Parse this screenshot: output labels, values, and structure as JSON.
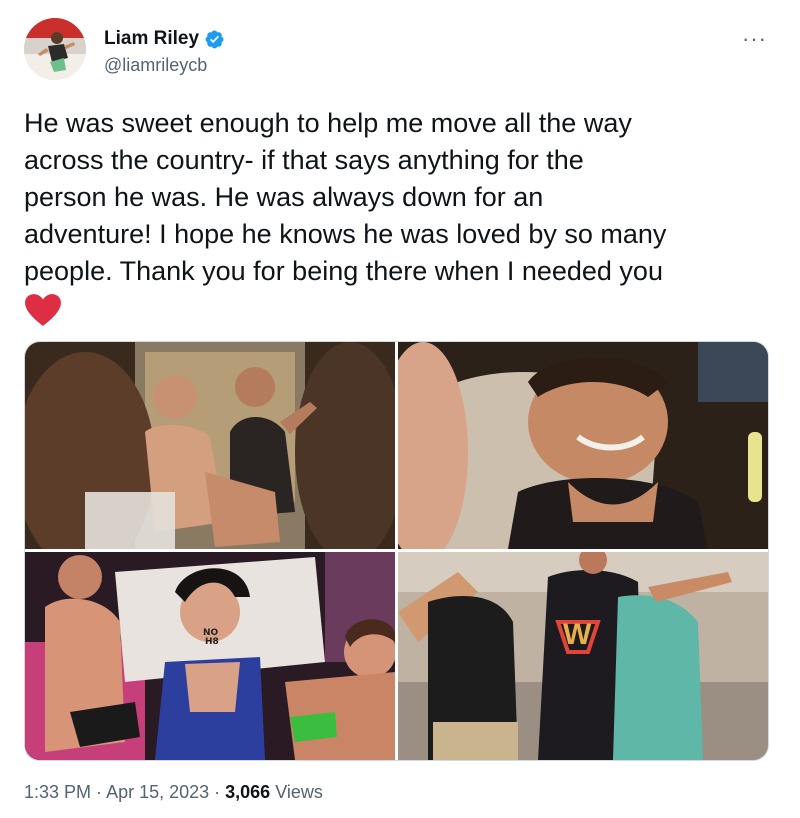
{
  "author": {
    "display_name": "Liam Riley",
    "handle": "@liamrileycb",
    "verified_icon": "verified-badge-icon",
    "badge_color": "#1d9bf0"
  },
  "tweet": {
    "text": "He was sweet enough to help me move all the way\nacross the country-  if that says anything for the\nperson he was. He was always down for an\nadventure! I hope he knows he was loved by so many\npeople. Thank you for being there when I needed you",
    "emoji": "red-heart-icon",
    "heart_color": "#dd2e44"
  },
  "media": {
    "photos": [
      {
        "id": "photo-1"
      },
      {
        "id": "photo-2"
      },
      {
        "id": "photo-3",
        "sticker_text": "NO\nH8"
      },
      {
        "id": "photo-4",
        "shirt_text": "W"
      }
    ]
  },
  "meta": {
    "time": "1:33 PM",
    "sep1": " · ",
    "date": "Apr 15, 2023",
    "sep2": " · ",
    "views_count": "3,066",
    "views_label": " Views"
  },
  "more_label": "···"
}
